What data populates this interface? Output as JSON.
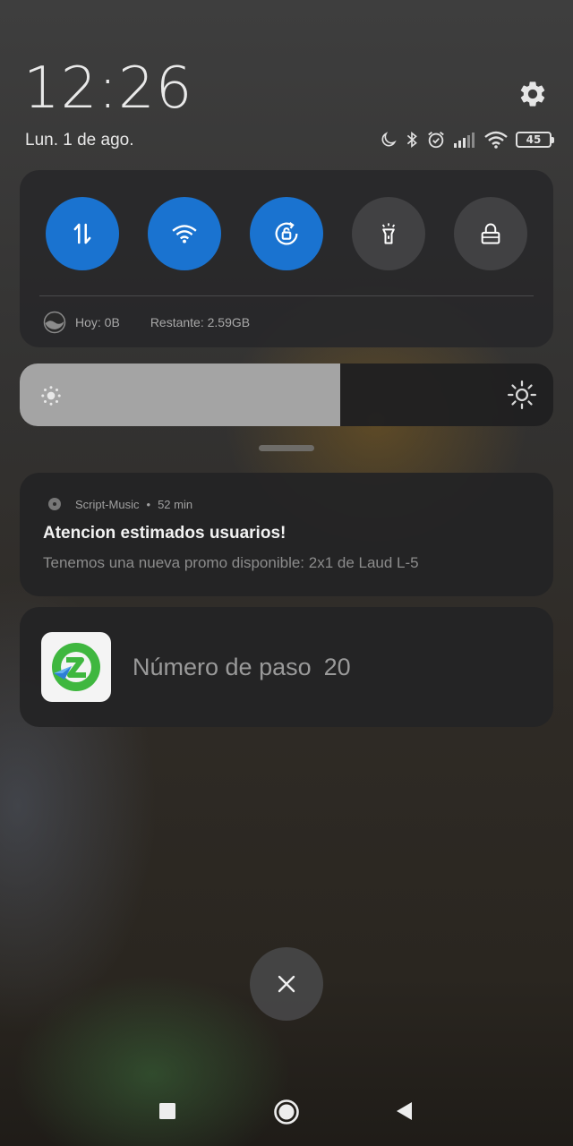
{
  "header": {
    "time": "12:26",
    "date": "Lun. 1 de ago.",
    "battery_level": "45",
    "status_icons": [
      "moon-icon",
      "bluetooth-icon",
      "alarm-icon",
      "cellular-signal-icon",
      "wifi-icon",
      "battery-icon"
    ]
  },
  "quick_settings": {
    "toggles": [
      {
        "name": "mobile-data",
        "icon": "arrows-up-down-icon",
        "state": "on"
      },
      {
        "name": "wifi",
        "icon": "wifi-icon",
        "state": "on"
      },
      {
        "name": "auto-rotate",
        "icon": "rotation-lock-icon",
        "state": "on"
      },
      {
        "name": "flashlight",
        "icon": "flashlight-icon",
        "state": "off"
      },
      {
        "name": "lock",
        "icon": "lock-icon",
        "state": "off"
      }
    ],
    "data_usage": {
      "today": "Hoy: 0B",
      "remaining": "Restante: 2.59GB"
    }
  },
  "brightness": {
    "level_fraction": 0.6
  },
  "notifications": [
    {
      "app": "Script-Music",
      "separator": "•",
      "time": "52 min",
      "title": "Atencion estimados usuarios!",
      "body": "Tenemos una nueva promo disponible: 2x1 de Laud L-5"
    },
    {
      "label": "Número de paso",
      "value": "20"
    }
  ],
  "colors": {
    "toggle_on": "#1a73d0",
    "toggle_off": "#414143",
    "panel": "#28282a",
    "step_app_green": "#3fb73f"
  }
}
